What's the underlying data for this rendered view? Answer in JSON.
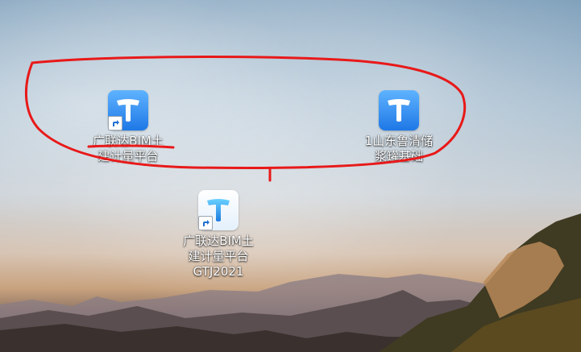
{
  "desktop": {
    "icons": [
      {
        "label_line1": "广联达BIM土",
        "label_line2": "建计量平台",
        "label_line3": "",
        "shortcut": true,
        "style": "blue"
      },
      {
        "label_line1": "1山东鲁清储",
        "label_line2": "浆罐基础",
        "label_line3": "",
        "shortcut": false,
        "style": "blue"
      },
      {
        "label_line1": "广联达BIM土",
        "label_line2": "建计量平台",
        "label_line3": "GTJ2021",
        "shortcut": true,
        "style": "light"
      }
    ]
  },
  "colors": {
    "annotation": "#e81919",
    "icon_blue_top": "#5fb3ff",
    "icon_blue_bottom": "#1e78e6"
  },
  "icon_glyph": "app-t-logo-icon"
}
